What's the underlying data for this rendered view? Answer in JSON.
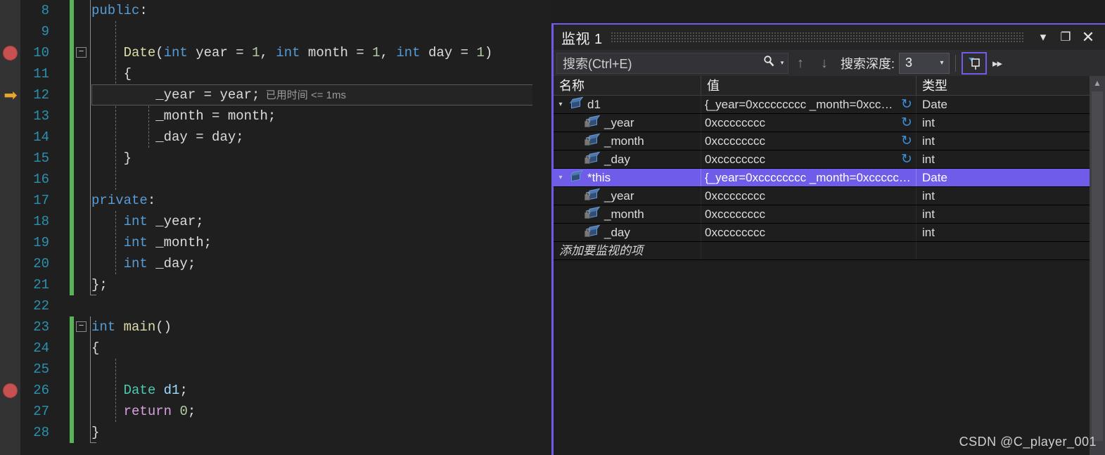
{
  "editor": {
    "breakpoint_lines": [
      10,
      26
    ],
    "current_line": 12,
    "inline_hint": "已用时间 <= 1ms",
    "lines": [
      {
        "num": "8",
        "tokens": [
          {
            "t": "public",
            "c": "kw"
          },
          {
            "t": ":",
            "c": "plain"
          }
        ]
      },
      {
        "num": "9",
        "tokens": []
      },
      {
        "num": "10",
        "fold": "−",
        "tokens": [
          {
            "t": "    ",
            "c": "plain"
          },
          {
            "t": "Date",
            "c": "fn"
          },
          {
            "t": "(",
            "c": "plain"
          },
          {
            "t": "int",
            "c": "kw"
          },
          {
            "t": " year ",
            "c": "plain"
          },
          {
            "t": "=",
            "c": "plain"
          },
          {
            "t": " ",
            "c": "plain"
          },
          {
            "t": "1",
            "c": "num"
          },
          {
            "t": ", ",
            "c": "plain"
          },
          {
            "t": "int",
            "c": "kw"
          },
          {
            "t": " month ",
            "c": "plain"
          },
          {
            "t": "=",
            "c": "plain"
          },
          {
            "t": " ",
            "c": "plain"
          },
          {
            "t": "1",
            "c": "num"
          },
          {
            "t": ", ",
            "c": "plain"
          },
          {
            "t": "int",
            "c": "kw"
          },
          {
            "t": " day ",
            "c": "plain"
          },
          {
            "t": "=",
            "c": "plain"
          },
          {
            "t": " ",
            "c": "plain"
          },
          {
            "t": "1",
            "c": "num"
          },
          {
            "t": ")",
            "c": "plain"
          }
        ]
      },
      {
        "num": "11",
        "tokens": [
          {
            "t": "    {",
            "c": "plain"
          }
        ]
      },
      {
        "num": "12",
        "tokens": [
          {
            "t": "        _year ",
            "c": "plain"
          },
          {
            "t": "=",
            "c": "plain"
          },
          {
            "t": " year;",
            "c": "plain"
          }
        ]
      },
      {
        "num": "13",
        "tokens": [
          {
            "t": "        _month ",
            "c": "plain"
          },
          {
            "t": "=",
            "c": "plain"
          },
          {
            "t": " month;",
            "c": "plain"
          }
        ]
      },
      {
        "num": "14",
        "tokens": [
          {
            "t": "        _day ",
            "c": "plain"
          },
          {
            "t": "=",
            "c": "plain"
          },
          {
            "t": " day;",
            "c": "plain"
          }
        ]
      },
      {
        "num": "15",
        "tokens": [
          {
            "t": "    }",
            "c": "plain"
          }
        ]
      },
      {
        "num": "16",
        "tokens": []
      },
      {
        "num": "17",
        "tokens": [
          {
            "t": "private",
            "c": "kw"
          },
          {
            "t": ":",
            "c": "plain"
          }
        ]
      },
      {
        "num": "18",
        "tokens": [
          {
            "t": "    ",
            "c": "plain"
          },
          {
            "t": "int",
            "c": "kw"
          },
          {
            "t": " _year;",
            "c": "plain"
          }
        ]
      },
      {
        "num": "19",
        "tokens": [
          {
            "t": "    ",
            "c": "plain"
          },
          {
            "t": "int",
            "c": "kw"
          },
          {
            "t": " _month;",
            "c": "plain"
          }
        ]
      },
      {
        "num": "20",
        "tokens": [
          {
            "t": "    ",
            "c": "plain"
          },
          {
            "t": "int",
            "c": "kw"
          },
          {
            "t": " _day;",
            "c": "plain"
          }
        ]
      },
      {
        "num": "21",
        "tokens": [
          {
            "t": "};",
            "c": "plain"
          }
        ]
      },
      {
        "num": "22",
        "tokens": []
      },
      {
        "num": "23",
        "fold": "−",
        "tokens": [
          {
            "t": "int",
            "c": "kw"
          },
          {
            "t": " ",
            "c": "plain"
          },
          {
            "t": "main",
            "c": "fn"
          },
          {
            "t": "()",
            "c": "plain"
          }
        ]
      },
      {
        "num": "24",
        "tokens": [
          {
            "t": "{",
            "c": "plain"
          }
        ]
      },
      {
        "num": "25",
        "tokens": []
      },
      {
        "num": "26",
        "tokens": [
          {
            "t": "    ",
            "c": "plain"
          },
          {
            "t": "Date",
            "c": "type"
          },
          {
            "t": " ",
            "c": "plain"
          },
          {
            "t": "d1",
            "c": "id"
          },
          {
            "t": ";",
            "c": "plain"
          }
        ]
      },
      {
        "num": "27",
        "tokens": [
          {
            "t": "    ",
            "c": "plain"
          },
          {
            "t": "return",
            "c": "kw2"
          },
          {
            "t": " ",
            "c": "plain"
          },
          {
            "t": "0",
            "c": "num"
          },
          {
            "t": ";",
            "c": "plain"
          }
        ]
      },
      {
        "num": "28",
        "tokens": [
          {
            "t": "}",
            "c": "plain"
          }
        ]
      }
    ]
  },
  "watch": {
    "title": "监视 1",
    "titlebar_buttons": {
      "dropdown": "▾",
      "maximize": "❐",
      "close": "✕"
    },
    "toolbar": {
      "search_placeholder": "搜索(Ctrl+E)",
      "search_value": "",
      "search_icon": "⌕",
      "search_dropdown_caret": "▾",
      "prev_arrow": "↑",
      "next_arrow": "↓",
      "depth_label": "搜索深度:",
      "depth_value": "3",
      "depth_caret": "▾",
      "pin_icon": "pin",
      "overflow": "▸▸"
    },
    "columns": [
      "名称",
      "值",
      "类型"
    ],
    "rows": [
      {
        "name": "d1",
        "value": "{_year=0xcccccccc _month=0xcccc...",
        "type": "Date",
        "level": 0,
        "expander": "▾",
        "refresh": true,
        "lock": false,
        "selected": false
      },
      {
        "name": "_year",
        "value": "0xcccccccc",
        "type": "int",
        "level": 1,
        "expander": "",
        "refresh": true,
        "lock": true,
        "selected": false
      },
      {
        "name": "_month",
        "value": "0xcccccccc",
        "type": "int",
        "level": 1,
        "expander": "",
        "refresh": true,
        "lock": true,
        "selected": false
      },
      {
        "name": "_day",
        "value": "0xcccccccc",
        "type": "int",
        "level": 1,
        "expander": "",
        "refresh": true,
        "lock": true,
        "selected": false
      },
      {
        "name": "*this",
        "value": "{_year=0xcccccccc _month=0xccccccc...",
        "type": "Date",
        "level": 0,
        "expander": "▾",
        "refresh": false,
        "lock": false,
        "selected": true
      },
      {
        "name": "_year",
        "value": "0xcccccccc",
        "type": "int",
        "level": 1,
        "expander": "",
        "refresh": false,
        "lock": true,
        "selected": false
      },
      {
        "name": "_month",
        "value": "0xcccccccc",
        "type": "int",
        "level": 1,
        "expander": "",
        "refresh": false,
        "lock": true,
        "selected": false
      },
      {
        "name": "_day",
        "value": "0xcccccccc",
        "type": "int",
        "level": 1,
        "expander": "",
        "refresh": false,
        "lock": true,
        "selected": false
      }
    ],
    "add_item_placeholder": "添加要监视的项",
    "scroll_up_arrow": "▲"
  },
  "watermark": "CSDN @C_player_001",
  "colors": {
    "accent": "#6f5ce8",
    "editor_bg": "#1e1e1e",
    "gutter_bg": "#333333",
    "line_number": "#2b91af",
    "breakpoint": "#c75050",
    "current_statement": "#e8a62c",
    "changed_bar": "#57b457",
    "selection": "#6f5ce8",
    "refresh_icon": "#3c8fd9"
  }
}
